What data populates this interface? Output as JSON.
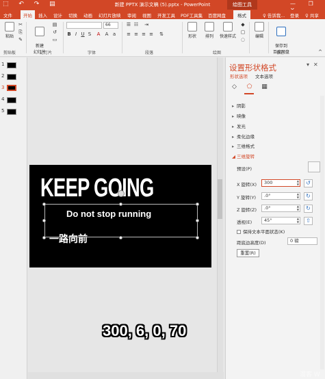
{
  "titlebar": {
    "quick_access": "⬚ ↶ ↷ ▤",
    "title": "新建 PPTX 演示文稿 (5).pptx - PowerPoint",
    "context_tab": "绘图工具",
    "window_controls": "— ❐ ✕"
  },
  "tabs": {
    "file": "文件",
    "home": "开始",
    "insert": "插入",
    "design": "设计",
    "transitions": "切换",
    "animations": "动画",
    "slideshow": "幻灯片放映",
    "review": "审阅",
    "view": "视图",
    "dev": "开发工具",
    "pdf": "PDF工具集",
    "baidu": "百度网盘",
    "format": "格式",
    "tell_me": "♀ 告诉我...",
    "user": "登录",
    "share": "♀ 共享"
  },
  "ribbon": {
    "paste": "粘贴",
    "clipboard_group": "剪贴板",
    "new_slide": "新建\n幻灯片",
    "slides_group": "幻灯片",
    "font_name": "",
    "font_size": "66",
    "font_group": "字体",
    "paragraph_group": "段落",
    "shapes": "形状",
    "arrange": "排列",
    "quick_styles": "快速样式",
    "drawing_group": "绘图",
    "editing": "编辑",
    "save_baidu": "保存到\n百度网盘",
    "save_group": "保存"
  },
  "slides": [
    {
      "num": "1",
      "active": false
    },
    {
      "num": "2",
      "active": false
    },
    {
      "num": "3",
      "active": true
    },
    {
      "num": "4",
      "active": false
    },
    {
      "num": "5",
      "active": false
    }
  ],
  "slide_content": {
    "headline": "KEEP GOING",
    "subline": "Do not stop running",
    "chinese_line": "一路向前"
  },
  "caption": "300, 6, 0, 70",
  "pane": {
    "title": "设置形状格式",
    "tab_shape": "形状选项",
    "tab_text": "文本选项",
    "close": "✕",
    "pin": "▾",
    "sections": {
      "shadow": "阴影",
      "reflection": "映像",
      "glow": "发光",
      "soft_edges": "柔化边缘",
      "format_3d": "三维格式",
      "rotation_3d": "三维旋转"
    },
    "preset_label": "预设(P)",
    "x_label": "X 旋转(X)",
    "x_value": "300",
    "y_label": "Y 旋转(Y)",
    "y_value": ".0°",
    "z_label": "Z 旋转(Z)",
    "z_value": ".0°",
    "perspective_label": "透视(E)",
    "perspective_value": "45°",
    "keep_flat": "保持文本平面状态(K)",
    "distance_label": "距底边高度(D)",
    "distance_value": "0 磅",
    "reset": "重置(R)"
  },
  "watermark": "溜客 W"
}
